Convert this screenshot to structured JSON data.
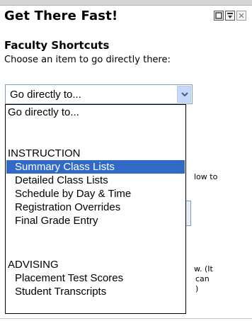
{
  "portlet": {
    "title": "Get There Fast!",
    "subtitle": "Faculty Shortcuts",
    "description": "Choose an item to go directly there:"
  },
  "dropdown": {
    "selected_value": "Go directly to...",
    "options": [
      {
        "label": "Go directly to...",
        "type": "placeholder"
      },
      {
        "label": "",
        "type": "separator"
      },
      {
        "label": "INSTRUCTION",
        "type": "group"
      },
      {
        "label": "Summary Class Lists",
        "type": "item",
        "highlighted": true
      },
      {
        "label": "Detailed Class Lists",
        "type": "item"
      },
      {
        "label": "Schedule by Day & Time",
        "type": "item"
      },
      {
        "label": "Registration Overrides",
        "type": "item"
      },
      {
        "label": "Final Grade Entry",
        "type": "item"
      },
      {
        "label": "",
        "type": "separator"
      },
      {
        "label": "ADVISING",
        "type": "group"
      },
      {
        "label": "Placement Test Scores",
        "type": "item"
      },
      {
        "label": "Student Transcripts",
        "type": "item"
      }
    ]
  },
  "background_text": {
    "line1": "low to",
    "line2": "w. (It",
    "line3": "can",
    "line4": ")"
  },
  "colors": {
    "highlight": "#316ac5",
    "select_border": "#7f9db9",
    "arrow_bg": "#c7d9fa"
  },
  "icons": [
    "minimize-icon",
    "maximize-icon",
    "close-icon",
    "chevron-down-icon"
  ]
}
